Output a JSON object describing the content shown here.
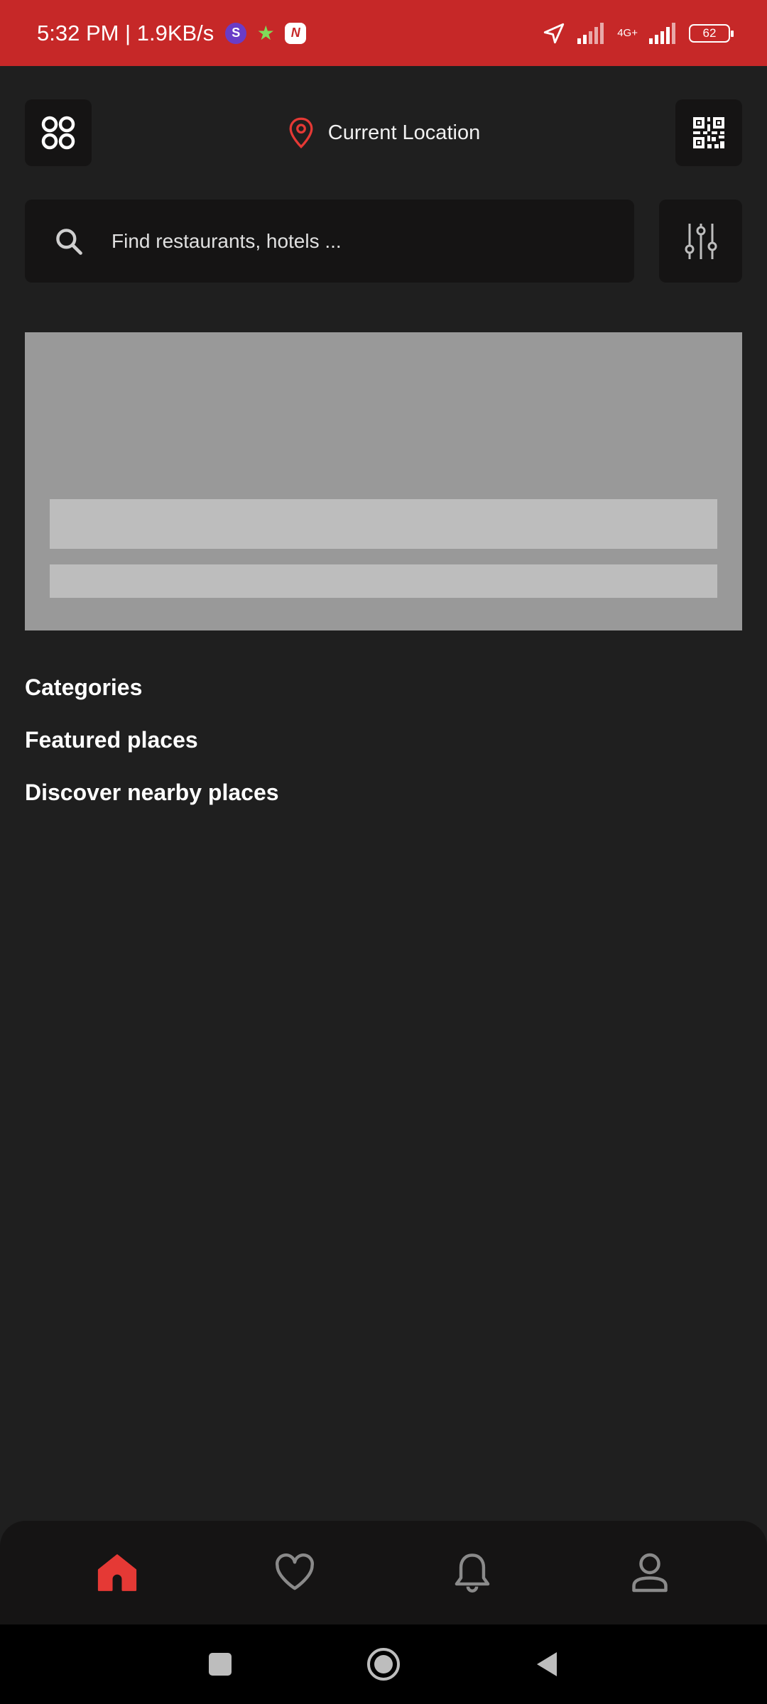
{
  "status_bar": {
    "time_speed": "5:32 PM | 1.9KB/s",
    "network_label": "4G+",
    "battery_level": "62"
  },
  "header": {
    "location_label": "Current Location"
  },
  "search": {
    "placeholder": "Find restaurants, hotels ..."
  },
  "sections": {
    "categories": "Categories",
    "featured": "Featured places",
    "nearby": "Discover nearby places"
  },
  "bottom_nav": {
    "items": [
      {
        "icon": "home-icon",
        "active": true
      },
      {
        "icon": "heart-icon",
        "active": false
      },
      {
        "icon": "bell-icon",
        "active": false
      },
      {
        "icon": "user-icon",
        "active": false
      }
    ]
  },
  "colors": {
    "accent": "#e53935",
    "status_bar": "#c62828",
    "background": "#1f1f1f",
    "card": "#151414",
    "skeleton_dark": "#999999",
    "skeleton_light": "#bdbdbd"
  }
}
